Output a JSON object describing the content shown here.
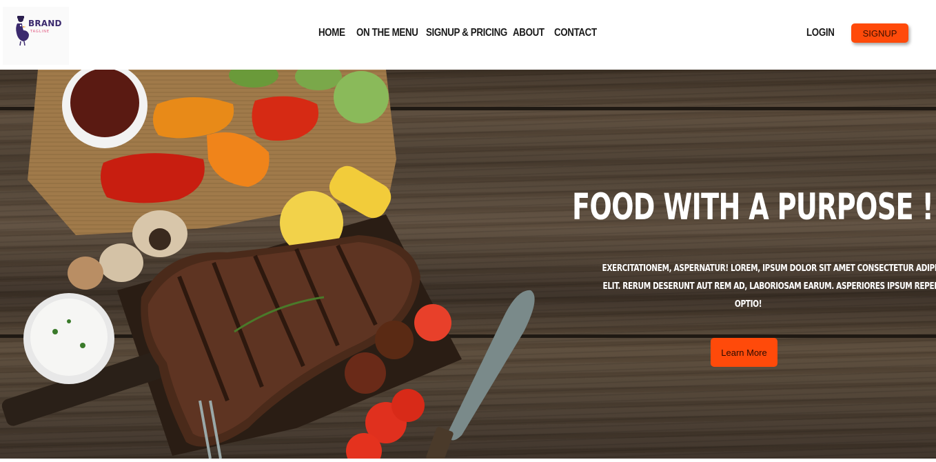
{
  "brand": {
    "name": "BRAND",
    "tagline": "TAGLINE",
    "logo_icon": "duck-mascot-icon"
  },
  "nav": {
    "items": [
      "HOME",
      "ON THE MENU",
      "SIGNUP & PRICING",
      "ABOUT",
      "CONTACT"
    ]
  },
  "auth": {
    "login_label": "LOGIN",
    "signup_label": "SIGNUP"
  },
  "hero": {
    "title": "FOOD WITH A PURPOSE !",
    "text_lines": [
      "EXERCITATIONEM, ASPERNATUR! LOREM, IPSUM DOLOR SIT AMET CONSECTETUR ADIPISICING",
      "ELIT. RERUM DESERUNT AUT REM AD, LABORIOSAM EARUM. ASPERIORES IPSUM REPELLENDUS",
      "OPTIO!"
    ],
    "button_label": "Learn More",
    "background_image": "grilled-steak-vegetables-on-wooden-table"
  },
  "colors": {
    "accent": "#ff4a0a",
    "nav_text": "#1a1a1a",
    "hero_text": "#ffffff"
  }
}
